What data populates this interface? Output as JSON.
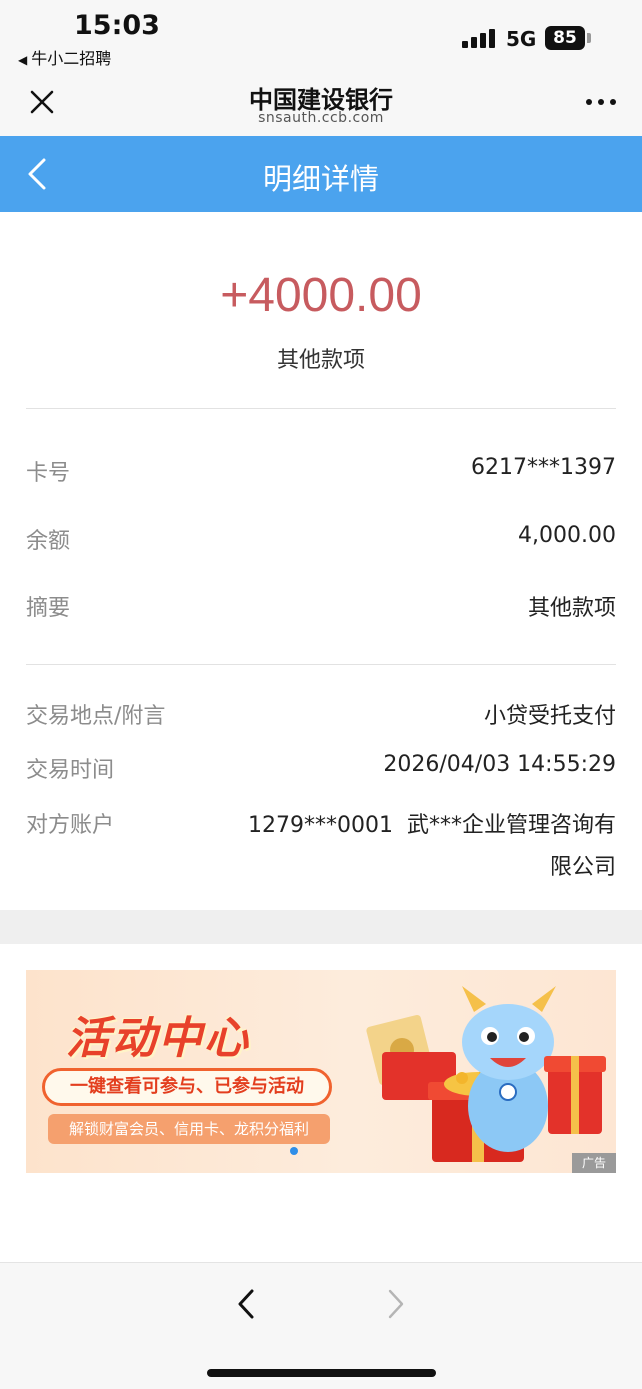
{
  "status_bar": {
    "time": "15:03",
    "back_app": "牛小二招聘",
    "network": "5G",
    "battery": "85"
  },
  "browser": {
    "title": "中国建设银行",
    "url": "snsauth.ccb.com",
    "close_icon": "close-icon",
    "more_icon": "more-icon"
  },
  "nav": {
    "title": "明细详情",
    "back_icon": "chevron-left-icon",
    "color": "#4ba3ee"
  },
  "summary": {
    "amount": "+4000.00",
    "amount_color": "#c75b5f",
    "type": "其他款项"
  },
  "details_1": [
    {
      "label": "卡号",
      "value": "6217***1397"
    },
    {
      "label": "余额",
      "value": "4,000.00"
    },
    {
      "label": "摘要",
      "value": "其他款项"
    }
  ],
  "details_2": {
    "location_label": "交易地点/附言",
    "location_value": "小贷受托支付",
    "time_label": "交易时间",
    "time_value": "2026/04/03 14:55:29",
    "counterparty_label": "对方账户",
    "counterparty_line1": "1279***0001  武***企业管理咨询有",
    "counterparty_line2": "限公司"
  },
  "banner": {
    "title": "活动中心",
    "pill1": "一键查看可参与、已参与活动",
    "pill2": "解锁财富会员、信用卡、龙积分福利",
    "ad_label": "广告"
  },
  "toolbar": {
    "back_icon": "chevron-left-icon",
    "forward_icon": "chevron-right-icon"
  }
}
